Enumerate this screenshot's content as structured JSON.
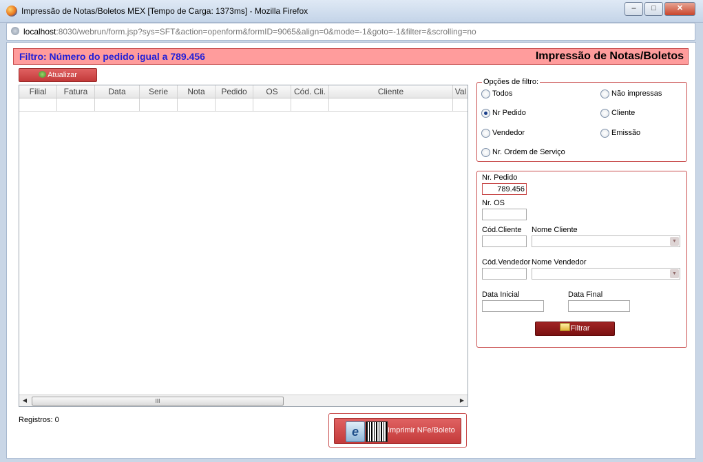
{
  "window": {
    "title": "Impressão de Notas/Boletos MEX [Tempo de Carga: 1373ms] - Mozilla Firefox",
    "url_host": "localhost",
    "url_rest": ":8030/webrun/form.jsp?sys=SFT&action=openform&formID=9065&align=0&mode=-1&goto=-1&filter=&scrolling=no",
    "minimize": "–",
    "maximize": "□",
    "close": "✕"
  },
  "header": {
    "filter_text": "Filtro: Número do pedido igual a 789.456",
    "page_title": "Impressão de Notas/Boletos"
  },
  "toolbar": {
    "refresh_label": "Atualizar"
  },
  "grid": {
    "columns": [
      "Filial",
      "Fatura",
      "Data",
      "Serie",
      "Nota",
      "Pedido",
      "OS",
      "Cód. Cli.",
      "Cliente",
      "Val"
    ],
    "scroll_thumb": "III"
  },
  "footer": {
    "records_label": "Registros: 0",
    "print_label": "Imprimir NFe/Boleto"
  },
  "filter_options": {
    "legend": "Opções de filtro:",
    "options": [
      "Todos",
      "Não impressas",
      "Nr Pedido",
      "Cliente",
      "Vendedor",
      "Emissão",
      "Nr. Ordem de Serviço"
    ],
    "selected": "Nr Pedido"
  },
  "form": {
    "pedido_label": "Nr. Pedido",
    "pedido_value": "789.456",
    "os_label": "Nr. OS",
    "cod_cliente_label": "Cód.Cliente",
    "nome_cliente_label": "Nome Cliente",
    "cod_vendedor_label": "Cód.Vendedor",
    "nome_vendedor_label": "Nome Vendedor",
    "data_inicial_label": "Data Inicial",
    "data_final_label": "Data Final",
    "filter_button": "Filtrar"
  },
  "colors": {
    "accent": "#c84b4b",
    "filter_text": "#1f1fd8",
    "header_bg": "#ff9c9c"
  }
}
